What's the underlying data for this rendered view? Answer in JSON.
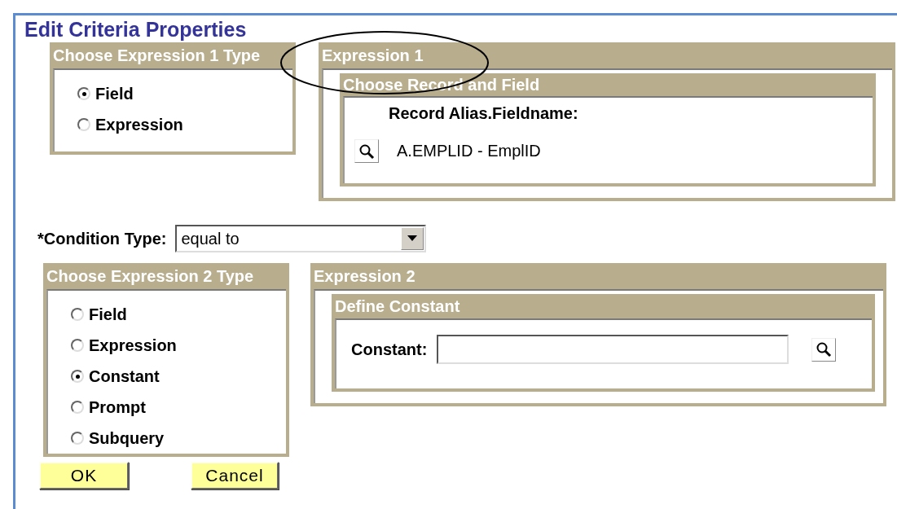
{
  "title": "Edit Criteria Properties",
  "expression1_type": {
    "title": "Choose Expression 1 Type",
    "options": [
      {
        "label": "Field",
        "selected": true
      },
      {
        "label": "Expression",
        "selected": false
      }
    ]
  },
  "expression1": {
    "title": "Expression 1",
    "section": {
      "title": "Choose Record and Field",
      "field_label": "Record Alias.Fieldname:",
      "value": "A.EMPLID - EmplID"
    }
  },
  "condition": {
    "label": "*Condition Type:",
    "value": "equal to"
  },
  "expression2_type": {
    "title": "Choose Expression 2 Type",
    "options": [
      {
        "label": "Field",
        "selected": false
      },
      {
        "label": "Expression",
        "selected": false
      },
      {
        "label": "Constant",
        "selected": true
      },
      {
        "label": "Prompt",
        "selected": false
      },
      {
        "label": "Subquery",
        "selected": false
      }
    ]
  },
  "expression2": {
    "title": "Expression 2",
    "section": {
      "title": "Define Constant",
      "field_label": "Constant:"
    }
  },
  "buttons": [
    "OK",
    "Cancel"
  ]
}
